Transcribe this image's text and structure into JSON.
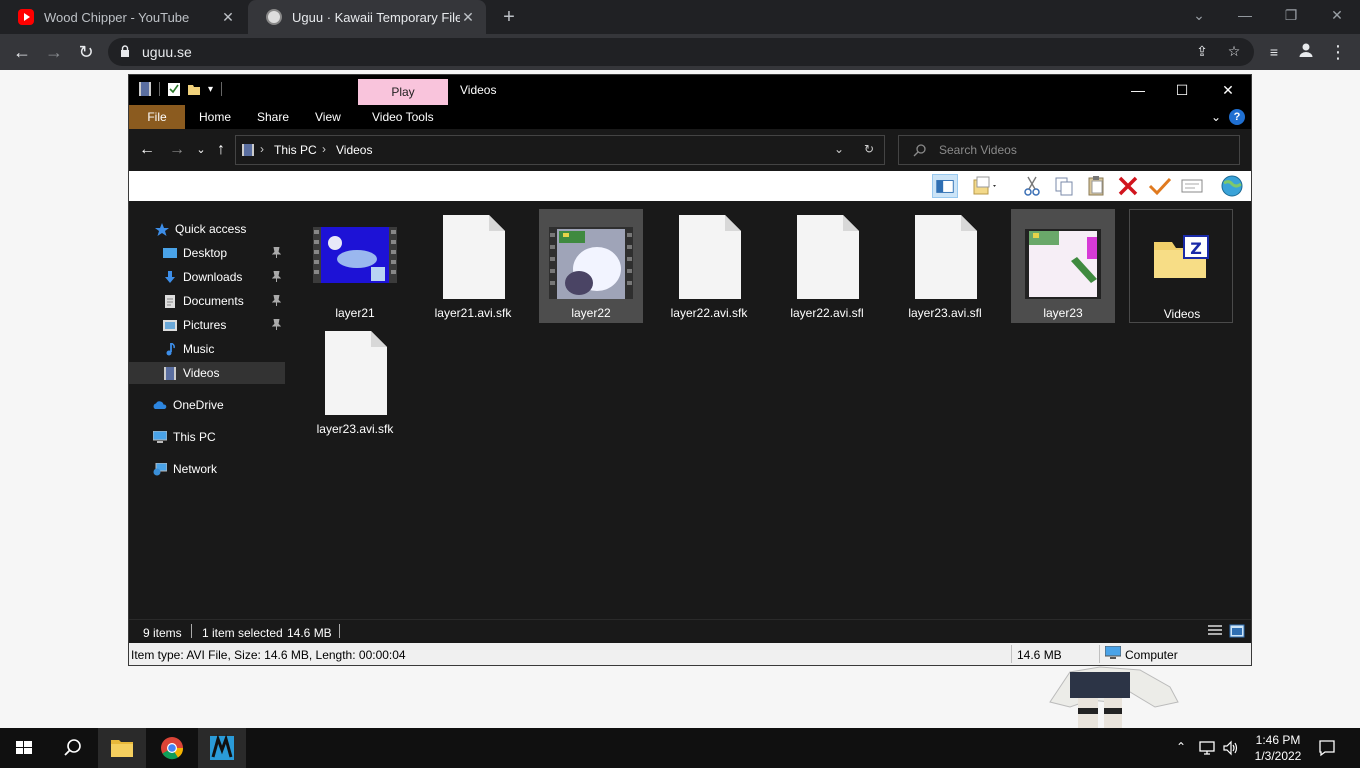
{
  "browser": {
    "tabs": [
      {
        "title": "Wood Chipper - YouTube",
        "favicon": "youtube-icon",
        "active": false
      },
      {
        "title": "Uguu · Kawaii Temporary File Ho",
        "favicon": "uguu-icon",
        "active": true
      }
    ],
    "url": "uguu.se"
  },
  "explorer": {
    "window_title": "Videos",
    "contextual_tab": "Play",
    "ribbon_tabs": [
      "File",
      "Home",
      "Share",
      "View",
      "Video Tools"
    ],
    "breadcrumb": [
      "This PC",
      "Videos"
    ],
    "search_placeholder": "Search Videos",
    "nav": {
      "quick_access": "Quick access",
      "items": [
        {
          "label": "Desktop",
          "pinned": true
        },
        {
          "label": "Downloads",
          "pinned": true
        },
        {
          "label": "Documents",
          "pinned": true
        },
        {
          "label": "Pictures",
          "pinned": true
        },
        {
          "label": "Music",
          "pinned": false
        },
        {
          "label": "Videos",
          "pinned": false,
          "selected": true
        }
      ],
      "onedrive": "OneDrive",
      "this_pc": "This PC",
      "network": "Network"
    },
    "files": [
      {
        "name": "layer21",
        "type": "video"
      },
      {
        "name": "layer21.avi.sfk",
        "type": "doc"
      },
      {
        "name": "layer22",
        "type": "video",
        "selected": true
      },
      {
        "name": "layer22.avi.sfk",
        "type": "doc"
      },
      {
        "name": "layer22.avi.sfl",
        "type": "doc"
      },
      {
        "name": "layer23.avi.sfl",
        "type": "doc"
      },
      {
        "name": "layer23",
        "type": "video",
        "selected": true
      },
      {
        "name": "Videos",
        "type": "folder"
      },
      {
        "name": "layer23.avi.sfk",
        "type": "doc"
      }
    ],
    "status": {
      "item_count": "9 items",
      "selection": "1 item selected",
      "size": "14.6 MB"
    },
    "details_bar": {
      "info": "Item type: AVI File, Size: 14.6 MB, Length: 00:00:04",
      "size": "14.6 MB",
      "location": "Computer"
    }
  },
  "taskbar": {
    "time": "1:46 PM",
    "date": "1/3/2022"
  },
  "colors": {
    "explorer_bg": "#191919",
    "file_tab": "#8b5b1f",
    "play_tab": "#f9c4dc",
    "selection": "#4d4d4d"
  }
}
